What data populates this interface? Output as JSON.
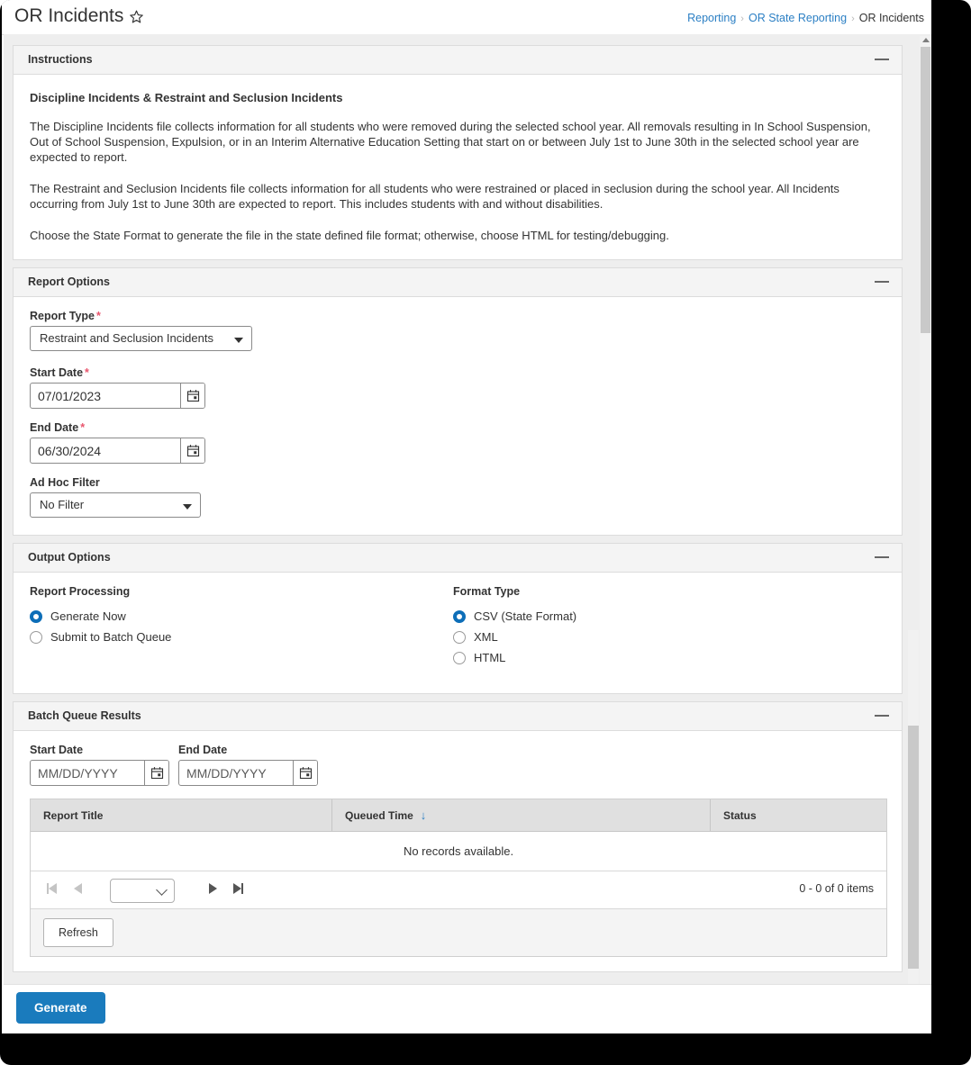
{
  "header": {
    "title": "OR Incidents",
    "favorite_icon": "star-icon",
    "breadcrumb": {
      "items": [
        "Reporting",
        "OR State Reporting"
      ],
      "current": "OR Incidents",
      "separator": "›"
    }
  },
  "instructions": {
    "section_title": "Instructions",
    "heading": "Discipline Incidents & Restraint and Seclusion Incidents",
    "paragraphs": [
      "The Discipline Incidents file collects information for all students who were removed during the selected school year. All removals resulting in In School Suspension, Out of School Suspension, Expulsion, or in an Interim Alternative Education Setting that start on or between July 1st to June 30th in the selected school year are expected to report.",
      "The Restraint and Seclusion Incidents file collects information for all students who were restrained or placed in seclusion during the school year. All Incidents occurring from July 1st to June 30th are expected to report. This includes students with and without disabilities.",
      "Choose the State Format to generate the file in the state defined file format; otherwise, choose HTML for testing/debugging."
    ]
  },
  "report_options": {
    "section_title": "Report Options",
    "report_type": {
      "label": "Report Type",
      "required_marker": "*",
      "value": "Restraint and Seclusion Incidents"
    },
    "start_date": {
      "label": "Start Date",
      "required_marker": "*",
      "value": "07/01/2023"
    },
    "end_date": {
      "label": "End Date",
      "required_marker": "*",
      "value": "06/30/2024"
    },
    "ad_hoc_filter": {
      "label": "Ad Hoc Filter",
      "value": "No Filter"
    }
  },
  "output_options": {
    "section_title": "Output Options",
    "report_processing": {
      "label": "Report Processing",
      "options": [
        {
          "label": "Generate Now",
          "selected": true
        },
        {
          "label": "Submit to Batch Queue",
          "selected": false
        }
      ]
    },
    "format_type": {
      "label": "Format Type",
      "options": [
        {
          "label": "CSV  (State Format)",
          "selected": true
        },
        {
          "label": "XML",
          "selected": false
        },
        {
          "label": "HTML",
          "selected": false
        }
      ]
    }
  },
  "batch_queue": {
    "section_title": "Batch Queue Results",
    "start_date": {
      "label": "Start Date",
      "placeholder": "MM/DD/YYYY",
      "value": ""
    },
    "end_date": {
      "label": "End Date",
      "placeholder": "MM/DD/YYYY",
      "value": ""
    },
    "table": {
      "columns": [
        "Report Title",
        "Queued Time",
        "Status"
      ],
      "sort_column": "Queued Time",
      "sort_arrow": "↓",
      "rows": [],
      "empty_message": "No records available."
    },
    "pager": {
      "page_size_value": "",
      "count_text": "0 - 0 of 0 items"
    },
    "refresh_label": "Refresh"
  },
  "actions": {
    "generate_label": "Generate"
  },
  "colors": {
    "accent_blue": "#1a7bbd",
    "link_blue": "#2b7fc4",
    "required_red": "#e8556d",
    "section_header_bg": "#f4f4f4",
    "table_header_bg": "#e0e0e0"
  }
}
